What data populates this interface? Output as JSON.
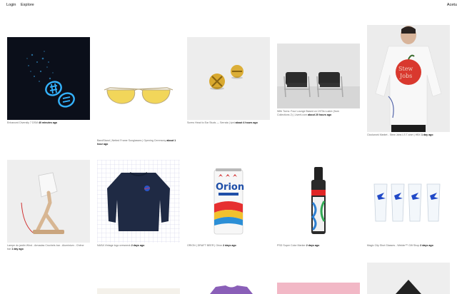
{
  "nav": {
    "login": "Login",
    "explore": "Explore",
    "user": "Acetu"
  },
  "items": [
    {
      "title": "Enhanced Diversity 7 DSM",
      "ago": "40 minutes ago",
      "icon": "crypto-coins-image"
    },
    {
      "title": "BandStand | Netted Frame Sunglasses | Opening Ceremony",
      "ago": "about 1 hour ago",
      "icon": "sunglasses-image"
    },
    {
      "title": "Screw Head to Ear Studs — Serrata | tpnt",
      "ago": "about 4 hours ago",
      "icon": "screw-earrings-image"
    },
    {
      "title": "With Turns: Four Lounge Based on 1970s Lustre (from Collections 2) | Liverti.com",
      "ago": "about 20 hours ago",
      "icon": "lounge-chairs-image"
    },
    {
      "title": "Clockwork Market - Stew Jobs LS T-shirt | HBX",
      "ago": "1 day ago",
      "icon": "apple-shirt-image"
    },
    {
      "title": "Lampe du jardin Wind - Armadas Crochets bar - Aluminium - Chêne bar",
      "ago": "1 day ago",
      "icon": "wooden-lamp-image"
    },
    {
      "title": "NASA Vintage logo crewneck",
      "ago": "2 days ago",
      "icon": "navy-sweater-image"
    },
    {
      "title": "ORION | DRAFT BEER | Orion",
      "ago": "2 days ago",
      "icon": "beer-can-image"
    },
    {
      "title": "PSD Super Color Marker",
      "ago": "2 days ago",
      "icon": "marker-bottle-image"
    },
    {
      "title": "Magic City Shot Glasses - Welder™ Gift Shop",
      "ago": "2 days ago",
      "icon": "shot-glasses-image"
    }
  ],
  "partial_row_colors": [
    "#f4f1ea",
    "#eeeeee",
    "#8a5fb8",
    "#f2b8c6",
    "#222222"
  ]
}
